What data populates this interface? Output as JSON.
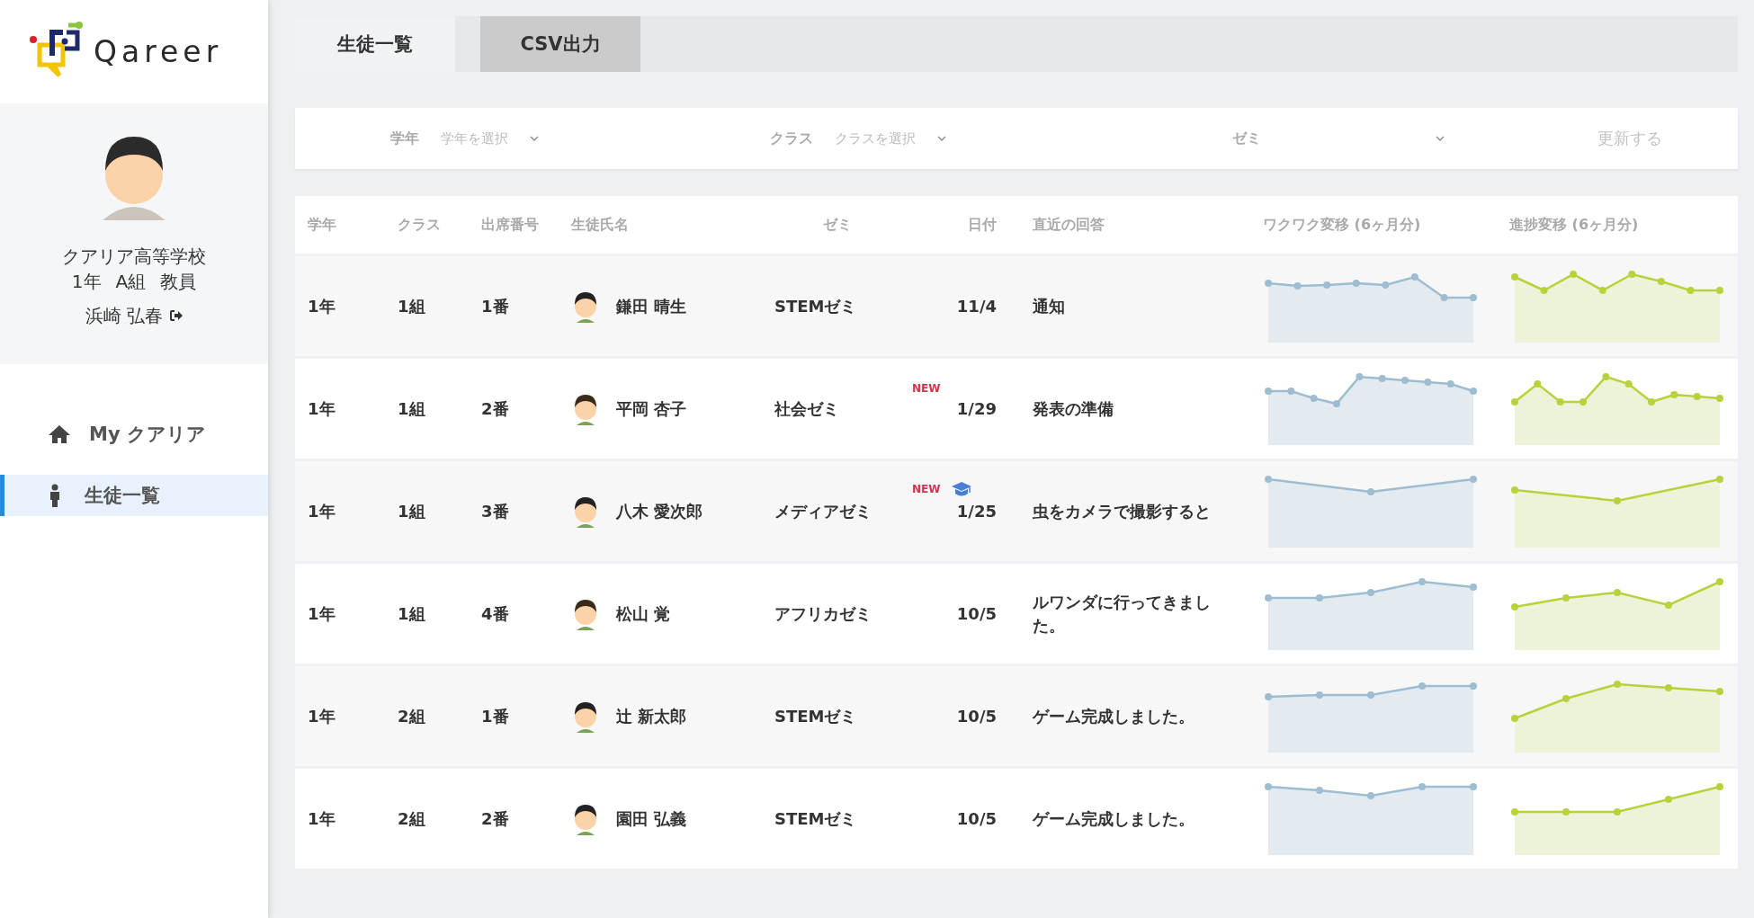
{
  "logo": {
    "text": "Qareer"
  },
  "profile": {
    "school": "クアリア高等学校",
    "grade": "1年",
    "class": "A組",
    "role": "教員",
    "name": "浜崎 弘春"
  },
  "nav": [
    {
      "kind": "home",
      "label": "My クアリア",
      "selected": false
    },
    {
      "kind": "person",
      "label": "生徒一覧",
      "selected": true
    }
  ],
  "tabs": [
    {
      "label": "生徒一覧",
      "selected": true
    },
    {
      "label": "CSV出力",
      "selected": false
    }
  ],
  "filters": [
    {
      "label": "学年",
      "placeholder": "学年を選択"
    },
    {
      "label": "クラス",
      "placeholder": "クラスを選択"
    },
    {
      "label": "ゼミ"
    }
  ],
  "update_button": {
    "label": "更新する",
    "disabled": true
  },
  "table": {
    "columns": [
      "学年",
      "クラス",
      "出席番号",
      "生徒氏名",
      "ゼミ",
      "日付",
      "直近の回答",
      "ワクワク変移 (6ヶ月分)",
      "進捗変移 (6ヶ月分)"
    ],
    "rows": [
      {
        "grade": "1年",
        "class": "1組",
        "number": "1番",
        "name": "鎌田 晴生",
        "seminar": "STEMゼミ",
        "date": "11/4",
        "graduated": false,
        "answer": "通知"
      },
      {
        "grade": "1年",
        "class": "1組",
        "number": "2番",
        "name": "平岡 杏子",
        "seminar": "社会ゼミ",
        "badge": "NEW",
        "date": "1/29",
        "graduated": false,
        "answer": "発表の準備"
      },
      {
        "grade": "1年",
        "class": "1組",
        "number": "3番",
        "name": "八木 愛次郎",
        "seminar": "メディアゼミ",
        "badge": "NEW",
        "date": "1/25",
        "graduated": true,
        "answer": "虫をカメラで撮影すると"
      },
      {
        "grade": "1年",
        "class": "1組",
        "number": "4番",
        "name": "松山 覚",
        "seminar": "アフリカゼミ",
        "date": "10/5",
        "graduated": false,
        "answer": "ルワンダに行ってきました。"
      },
      {
        "grade": "1年",
        "class": "2組",
        "number": "1番",
        "name": "辻 新太郎",
        "seminar": "STEMゼミ",
        "date": "10/5",
        "graduated": false,
        "answer": "ゲーム完成しました。"
      },
      {
        "grade": "1年",
        "class": "2組",
        "number": "2番",
        "name": "園田 弘義",
        "seminar": "STEMゼミ",
        "date": "10/5",
        "graduated": false,
        "answer": "ゲーム完成しました。"
      }
    ]
  }
}
